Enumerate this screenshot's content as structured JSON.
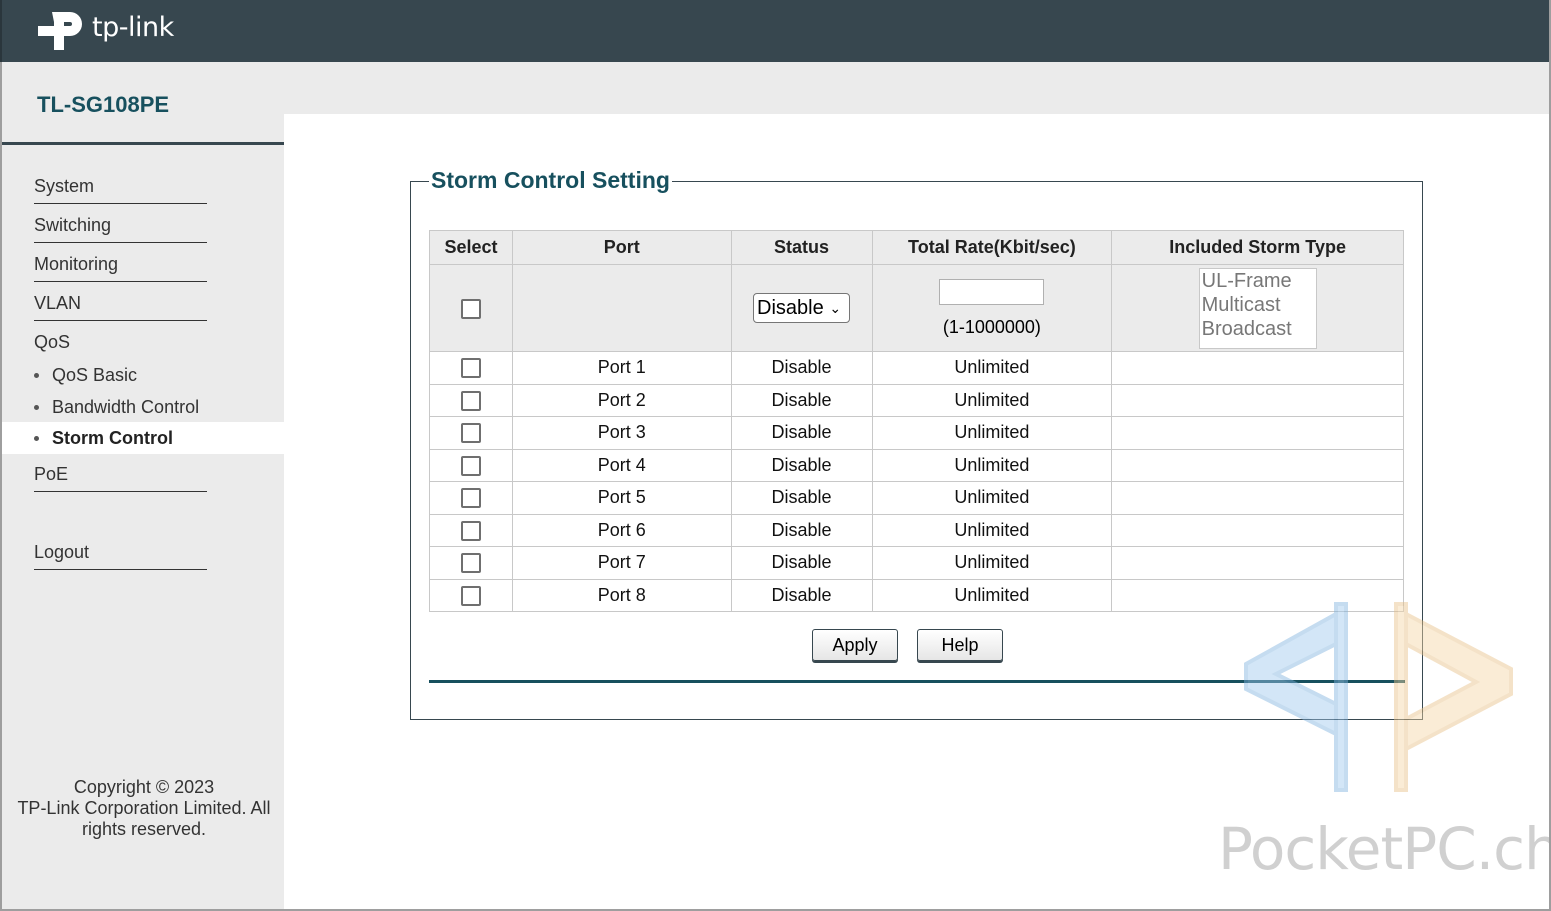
{
  "brand": {
    "logo_text": "tp-link",
    "logo_icon": "tp-link-logo-icon"
  },
  "sidebar": {
    "model": "TL-SG108PE",
    "items": [
      {
        "label": "System"
      },
      {
        "label": "Switching"
      },
      {
        "label": "Monitoring"
      },
      {
        "label": "VLAN"
      },
      {
        "label": "QoS"
      }
    ],
    "qos_sub": [
      {
        "label": "QoS Basic"
      },
      {
        "label": "Bandwidth Control"
      },
      {
        "label": "Storm Control",
        "active": true
      }
    ],
    "poe": {
      "label": "PoE"
    },
    "logout": {
      "label": "Logout"
    },
    "copyright": [
      "Copyright © 2023",
      "TP-Link Corporation Limited. All",
      "rights reserved."
    ]
  },
  "main": {
    "title": "Storm Control Setting",
    "headers": {
      "select": "Select",
      "port": "Port",
      "status": "Status",
      "rate": "Total Rate(Kbit/sec)",
      "storm_type": "Included Storm Type"
    },
    "controls": {
      "status_value": "Disable",
      "rate_value": "",
      "rate_range": "(1-1000000)",
      "storm_types": [
        "UL-Frame",
        "Multicast",
        "Broadcast"
      ]
    },
    "rows": [
      {
        "port": "Port 1",
        "status": "Disable",
        "rate": "Unlimited",
        "type": ""
      },
      {
        "port": "Port 2",
        "status": "Disable",
        "rate": "Unlimited",
        "type": ""
      },
      {
        "port": "Port 3",
        "status": "Disable",
        "rate": "Unlimited",
        "type": ""
      },
      {
        "port": "Port 4",
        "status": "Disable",
        "rate": "Unlimited",
        "type": ""
      },
      {
        "port": "Port 5",
        "status": "Disable",
        "rate": "Unlimited",
        "type": ""
      },
      {
        "port": "Port 6",
        "status": "Disable",
        "rate": "Unlimited",
        "type": ""
      },
      {
        "port": "Port 7",
        "status": "Disable",
        "rate": "Unlimited",
        "type": ""
      },
      {
        "port": "Port 8",
        "status": "Disable",
        "rate": "Unlimited",
        "type": ""
      }
    ],
    "buttons": {
      "apply": "Apply",
      "help": "Help"
    }
  },
  "watermark": {
    "text": "PocketPC.ch"
  },
  "colors": {
    "topbar": "#37474f",
    "accent": "#17505e",
    "sidebar_bg": "#ebebeb"
  }
}
